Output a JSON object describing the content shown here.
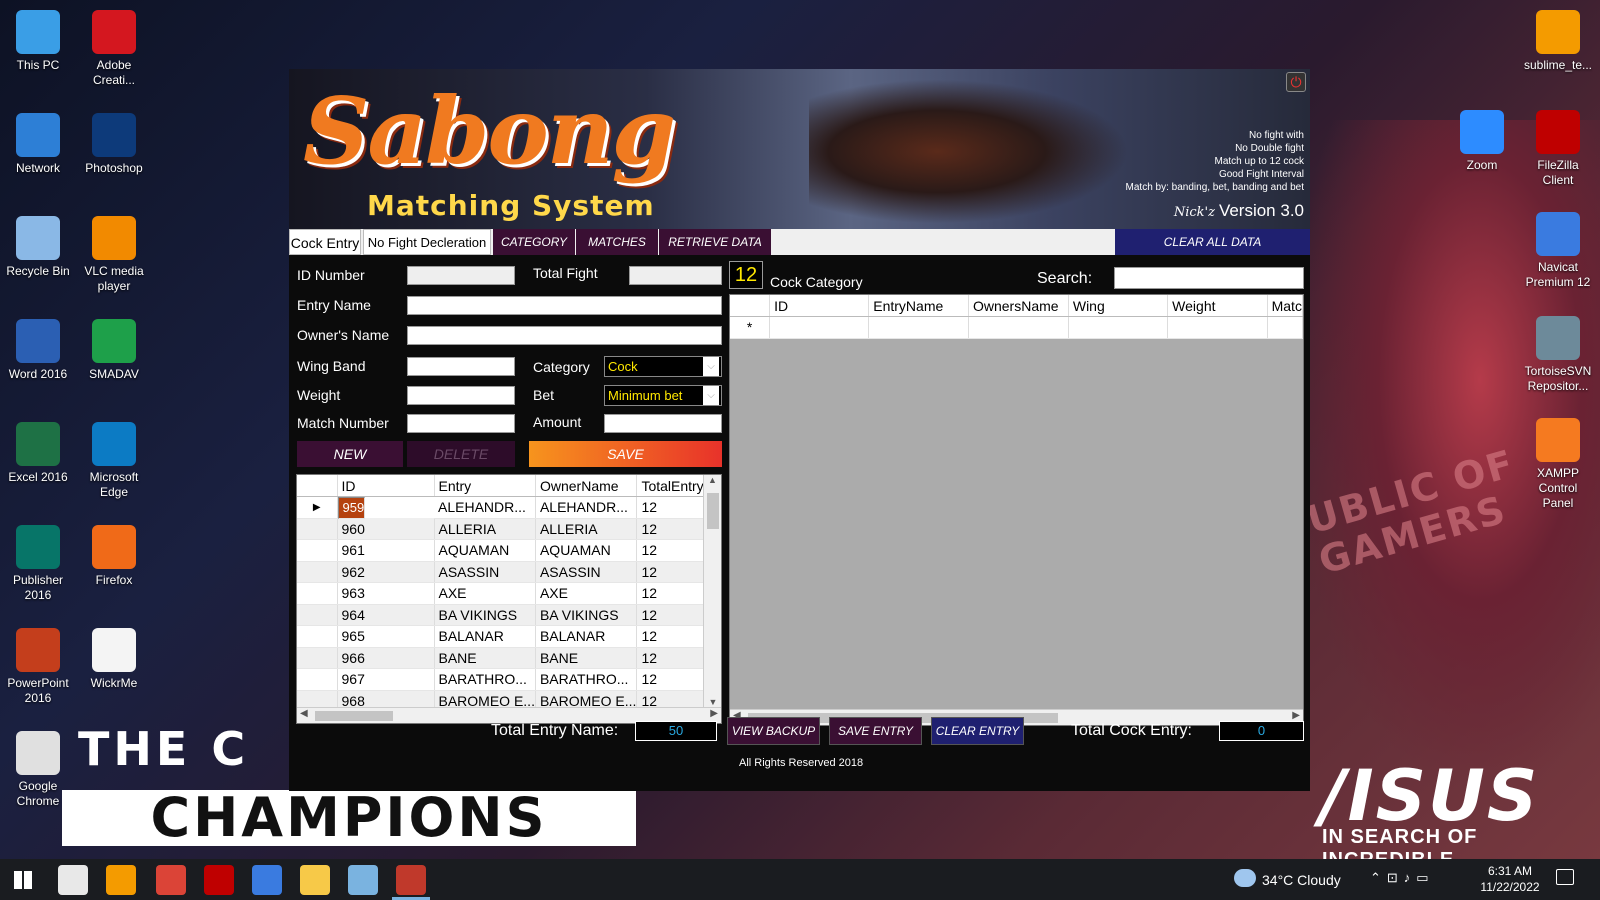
{
  "desktop": {
    "left_icons": [
      {
        "label": "This PC",
        "icon": "computer-icon",
        "color": "#3a9ee6"
      },
      {
        "label": "Adobe Creati...",
        "icon": "creative-cloud-icon",
        "color": "#d4171f"
      },
      {
        "label": "Network",
        "icon": "network-icon",
        "color": "#2d7fd6"
      },
      {
        "label": "Photoshop",
        "icon": "photoshop-icon",
        "color": "#0d3a7a"
      },
      {
        "label": "Recycle Bin",
        "icon": "recycle-bin-icon",
        "color": "#8ab8e6"
      },
      {
        "label": "VLC media player",
        "icon": "vlc-icon",
        "color": "#f28a00"
      },
      {
        "label": "Word 2016",
        "icon": "word-icon",
        "color": "#2b5fb3"
      },
      {
        "label": "SMADAV",
        "icon": "smadav-icon",
        "color": "#1ea04a"
      },
      {
        "label": "Excel 2016",
        "icon": "excel-icon",
        "color": "#1e7145"
      },
      {
        "label": "Microsoft Edge",
        "icon": "edge-icon",
        "color": "#0c7bc4"
      },
      {
        "label": "Publisher 2016",
        "icon": "publisher-icon",
        "color": "#077568"
      },
      {
        "label": "Firefox",
        "icon": "firefox-icon",
        "color": "#f06a18"
      },
      {
        "label": "PowerPoint 2016",
        "icon": "powerpoint-icon",
        "color": "#c43e1c"
      },
      {
        "label": "WickrMe",
        "icon": "wickrme-icon",
        "color": "#f4f4f4"
      },
      {
        "label": "Google Chrome",
        "icon": "chrome-icon",
        "color": "#e0e0e0"
      }
    ],
    "right_icons": [
      {
        "label": "sublime_te...",
        "icon": "sublime-text-icon",
        "color": "#f49b00"
      },
      {
        "label": "Zoom",
        "icon": "zoom-icon",
        "color": "#2d8cff"
      },
      {
        "label": "FileZilla Client",
        "icon": "filezilla-icon",
        "color": "#bf0000"
      },
      {
        "label": "Navicat Premium 12",
        "icon": "navicat-icon",
        "color": "#3a7be0"
      },
      {
        "label": "TortoiseSVN Repositor...",
        "icon": "tortoisesvn-icon",
        "color": "#6d8a9a"
      },
      {
        "label": "XAMPP Control Panel",
        "icon": "xampp-icon",
        "color": "#f57a20"
      }
    ],
    "wallpaper_text_1": "THE C",
    "wallpaper_text_2": "CHAMPIONS",
    "wallpaper_text_3": "UBLIC OF\nGAMERS",
    "asus_logo": "/ISUS",
    "asus_tagline": "IN SEARCH OF INCREDIBLE"
  },
  "app": {
    "logo": "Sabong",
    "subtitle": "Matching System",
    "notes": [
      "No fight with",
      "No Double fight",
      "Match up to 12 cock",
      "Good Fight Interval",
      "Match by: banding, bet, banding and bet"
    ],
    "signature": "Nick'z",
    "version": "Version 3.0",
    "tabs": {
      "cock_entry": "Cock Entry",
      "no_fight": "No Fight Decleration",
      "category": "CATEGORY",
      "matches": "MATCHES",
      "retrieve": "RETRIEVE DATA",
      "clear_all": "CLEAR ALL DATA"
    },
    "form": {
      "id_number": "ID Number",
      "total_fight": "Total Fight",
      "entry_name": "Entry Name",
      "owners_name": "Owner's Name",
      "wing_band": "Wing Band",
      "category": "Category",
      "category_value": "Cock",
      "weight": "Weight",
      "bet": "Bet",
      "bet_value": "Minimum bet",
      "match_number": "Match Number",
      "amount": "Amount"
    },
    "buttons": {
      "new": "NEW",
      "delete": "DELETE",
      "save": "SAVE",
      "view_backup": "VIEW BACKUP",
      "save_entry": "SAVE ENTRY",
      "clear_entry": "CLEAR ENTRY"
    },
    "entries_table": {
      "columns": [
        "ID",
        "Entry",
        "OwnerName",
        "TotalEntry"
      ],
      "rows": [
        [
          "959",
          "ALEHANDR...",
          "ALEHANDR...",
          "12"
        ],
        [
          "960",
          "ALLERIA",
          "ALLERIA",
          "12"
        ],
        [
          "961",
          "AQUAMAN",
          "AQUAMAN",
          "12"
        ],
        [
          "962",
          "ASASSIN",
          "ASASSIN",
          "12"
        ],
        [
          "963",
          "AXE",
          "AXE",
          "12"
        ],
        [
          "964",
          "BA VIKINGS",
          "BA VIKINGS",
          "12"
        ],
        [
          "965",
          "BALANAR",
          "BALANAR",
          "12"
        ],
        [
          "966",
          "BANE",
          "BANE",
          "12"
        ],
        [
          "967",
          "BARATHRO...",
          "BARATHRO...",
          "12"
        ],
        [
          "968",
          "BAROMEO E...",
          "BAROMEO E...",
          "12"
        ]
      ]
    },
    "cock_panel": {
      "count": "12",
      "title": "Cock Category",
      "search_label": "Search:",
      "columns": [
        "ID",
        "EntryName",
        "OwnersName",
        "Wing",
        "Weight",
        "Matc"
      ],
      "new_row_marker": "*"
    },
    "footer": {
      "total_entry_label": "Total Entry Name:",
      "total_entry_value": "50",
      "total_cock_label": "Total Cock Entry:",
      "total_cock_value": "0",
      "copyright": "All Rights Reserved 2018"
    }
  },
  "taskbar": {
    "weather": "34°C  Cloudy",
    "time": "6:31 AM",
    "date": "11/22/2022",
    "apps": [
      {
        "icon": "windows-start-icon",
        "color": "#ffffff"
      },
      {
        "icon": "search-app-icon",
        "color": "#e8e8e8"
      },
      {
        "icon": "sublime-text-icon",
        "color": "#f49b00"
      },
      {
        "icon": "chrome-icon",
        "color": "#db4437"
      },
      {
        "icon": "filezilla-icon",
        "color": "#bf0000"
      },
      {
        "icon": "navicat-icon",
        "color": "#3a7be0"
      },
      {
        "icon": "file-explorer-icon",
        "color": "#f7c948"
      },
      {
        "icon": "app-icon",
        "color": "#7ab3e0"
      },
      {
        "icon": "sabong-app-icon",
        "color": "#c0392b"
      }
    ]
  }
}
